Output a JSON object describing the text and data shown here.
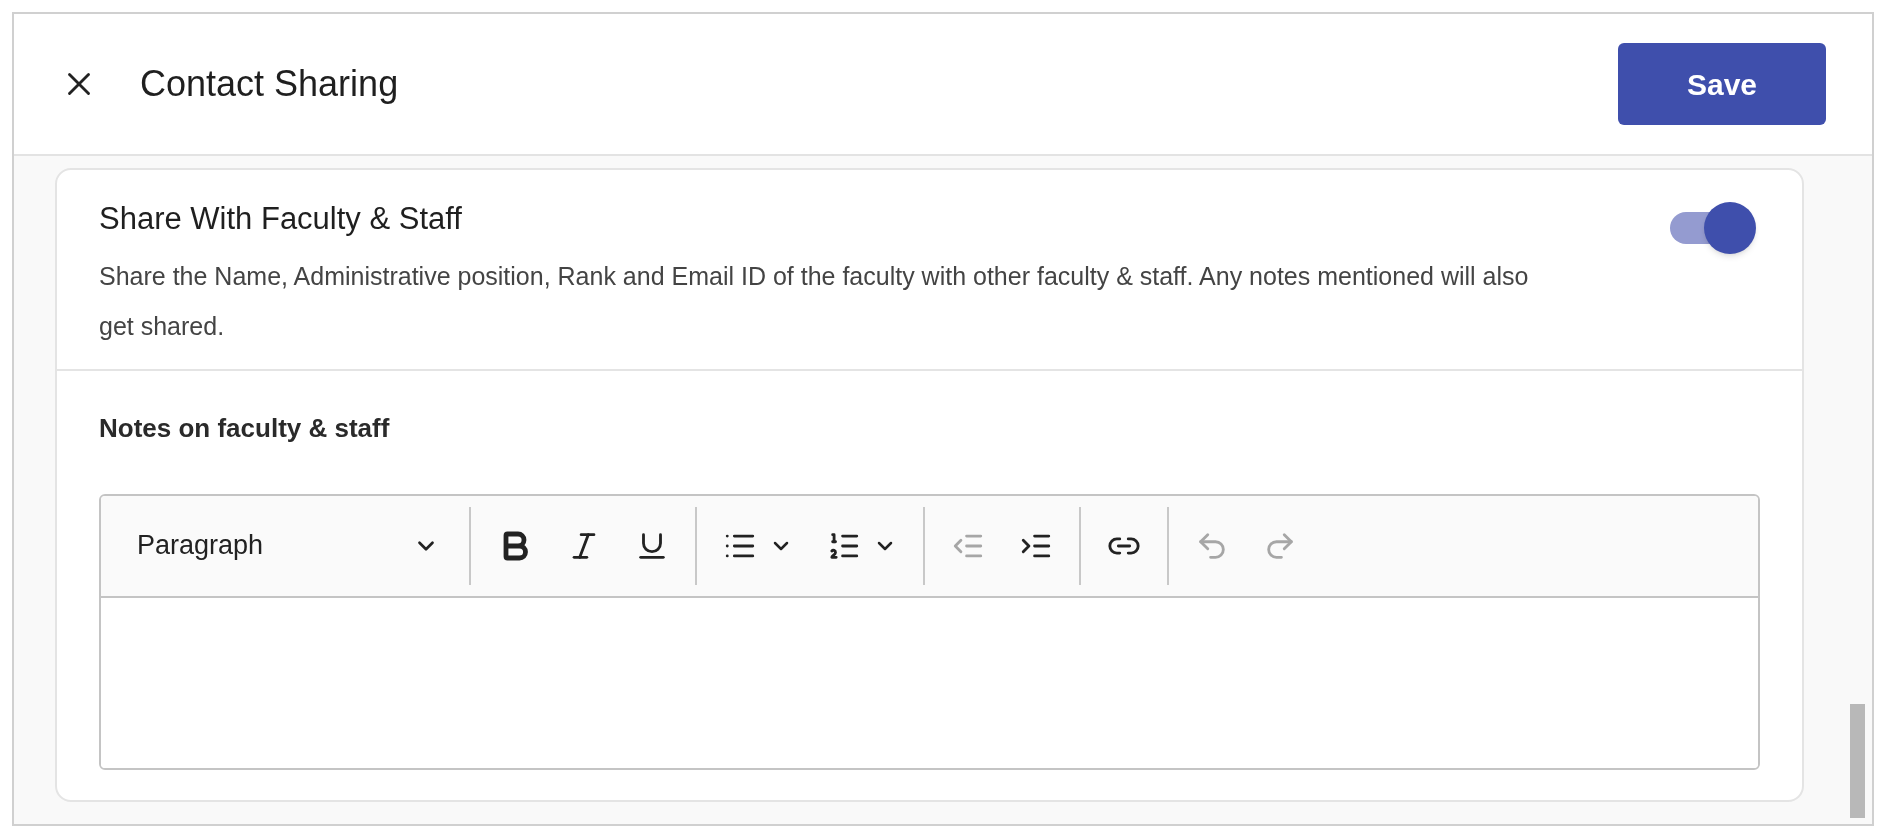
{
  "dialog": {
    "title": "Contact Sharing",
    "save_button": "Save"
  },
  "section": {
    "title": "Share With Faculty & Staff",
    "description": "Share the Name, Administrative position, Rank and Email ID of the faculty with other faculty & staff. Any notes mentioned will also get shared.",
    "on": true
  },
  "notes": {
    "label": "Notes on faculty & staff",
    "format_dropdown": "Paragraph",
    "toolbar_groups": [
      [
        {
          "kind": "bold",
          "disabled": false
        },
        {
          "kind": "italic",
          "disabled": false
        },
        {
          "kind": "underline",
          "disabled": false
        }
      ],
      [
        {
          "kind": "bullet-list",
          "disabled": false
        },
        {
          "kind": "numbered-list",
          "disabled": false
        }
      ],
      [
        {
          "kind": "outdent",
          "disabled": true
        },
        {
          "kind": "indent",
          "disabled": false
        }
      ],
      [
        {
          "kind": "link",
          "disabled": false
        }
      ],
      [
        {
          "kind": "undo",
          "disabled": true
        },
        {
          "kind": "redo",
          "disabled": true
        }
      ]
    ]
  }
}
